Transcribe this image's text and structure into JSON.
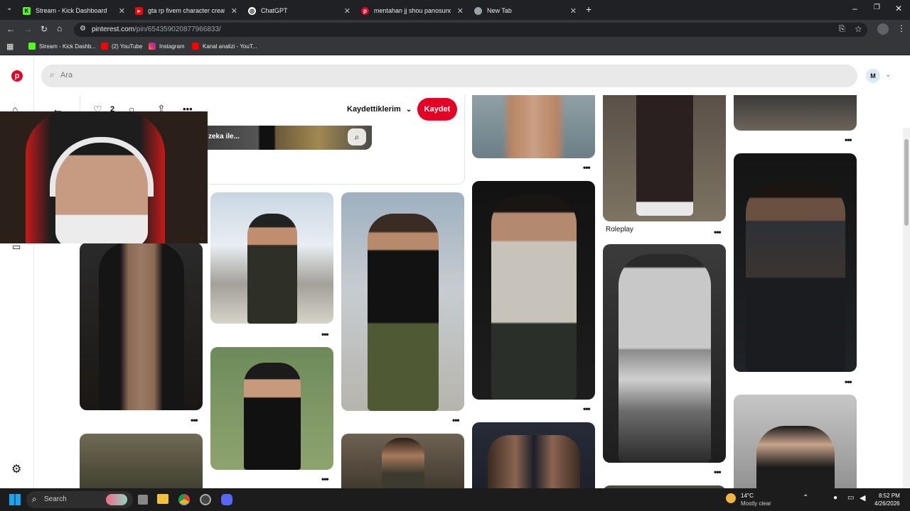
{
  "browser": {
    "tabs": [
      {
        "title": "Stream - Kick Dashboard"
      },
      {
        "title": "gta rp fivem character creation"
      },
      {
        "title": "ChatGPT"
      },
      {
        "title": "mentahan jj shou panosundaki"
      },
      {
        "title": "New Tab"
      }
    ],
    "url_domain": "pinterest.com",
    "url_path": "/pin/654359020877966833/",
    "bookmarks": [
      {
        "label": "Stream - Kick Dashb..."
      },
      {
        "label": "(2) YouTube"
      },
      {
        "label": "Instagram"
      },
      {
        "label": "Kanal analizi - YouT..."
      }
    ]
  },
  "pinterest": {
    "search_placeholder": "Ara",
    "avatar_initial": "M",
    "saved_boards_label": "Kaydettiklerim",
    "save_button_label": "Kaydet",
    "like_count": "2",
    "related_snippet": "zeka ile...",
    "roleplay_label": "Roleplay"
  },
  "taskbar": {
    "search_label": "Search",
    "weather_temp": "14°C",
    "weather_desc": "Mostly clear",
    "time": "8:52 PM",
    "date": "4/26/2026"
  },
  "colors": {
    "pinterest_red": "#e60023",
    "kick_green": "#53fc18",
    "youtube_red": "#ff0000"
  }
}
